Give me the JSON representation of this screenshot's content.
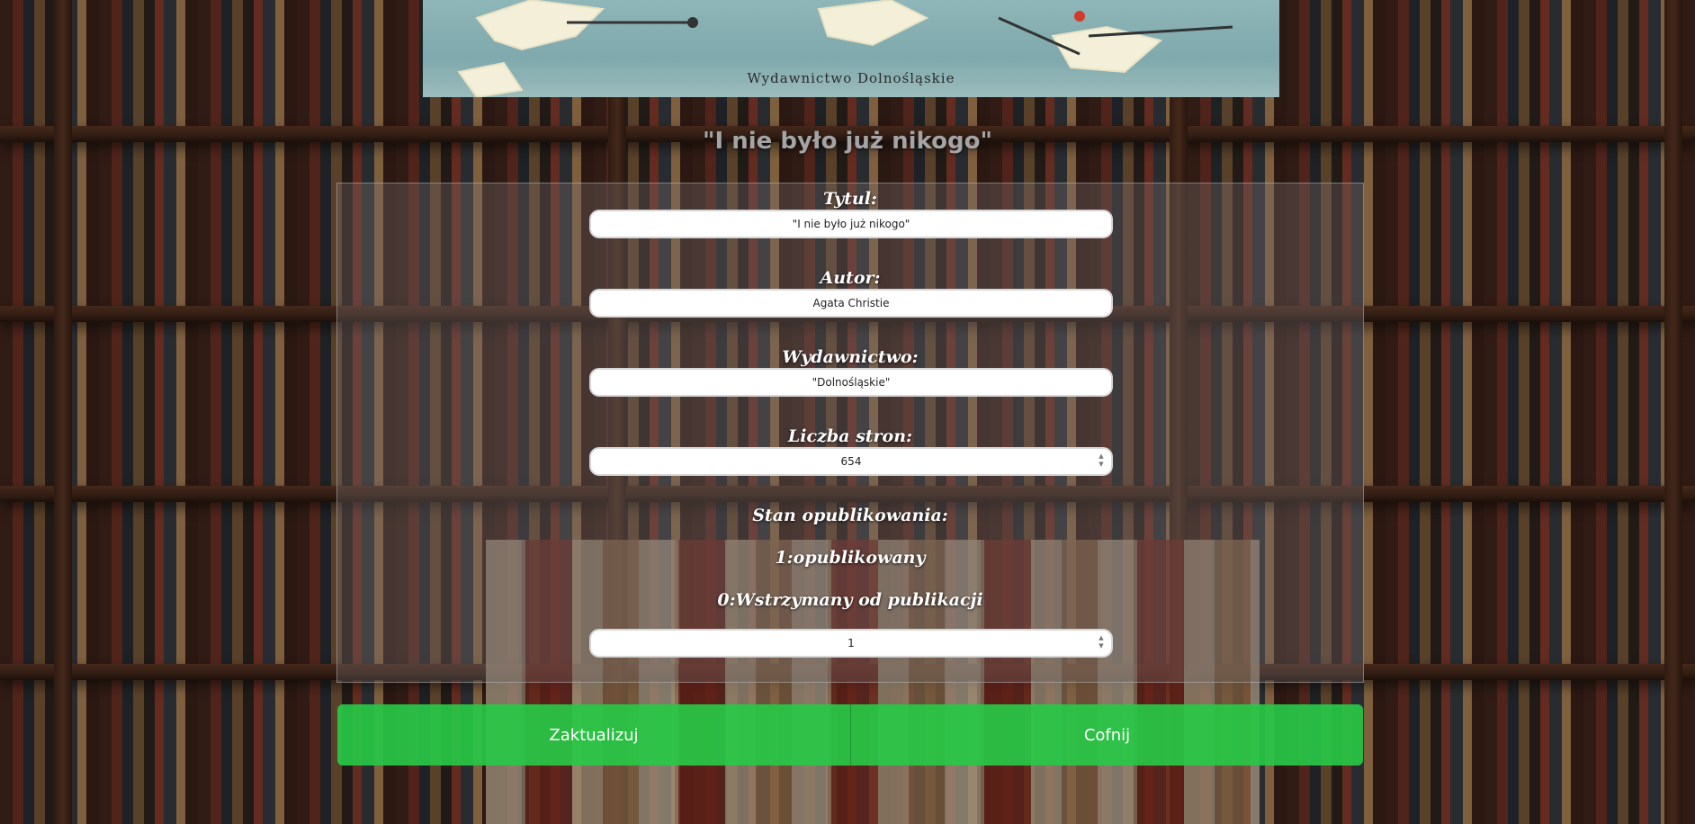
{
  "banner": {
    "caption": "Wydawnictwo Dolnośląskie"
  },
  "page_title": "\"I nie było już nikogo\"",
  "form": {
    "title_label": "Tytul:",
    "title_value": "\"I nie było już nikogo\"",
    "author_label": "Autor:",
    "author_value": "Agata Christie",
    "publisher_label": "Wydawnictwo:",
    "publisher_value": "\"Dolnośląskie\"",
    "pages_label": "Liczba stron:",
    "pages_value": "654",
    "status_label": "Stan opublikowania:",
    "status_hint_1": "1:opublikowany",
    "status_hint_0": "0:Wstrzymany od publikacji",
    "status_value": "1"
  },
  "buttons": {
    "update": "Zaktualizuj",
    "back": "Cofnij"
  },
  "colors": {
    "button_green": "#28c846",
    "label_white": "#ffffff",
    "title_gray": "#a4a4a4"
  },
  "icons": {
    "spinner": "up-down-arrows"
  }
}
